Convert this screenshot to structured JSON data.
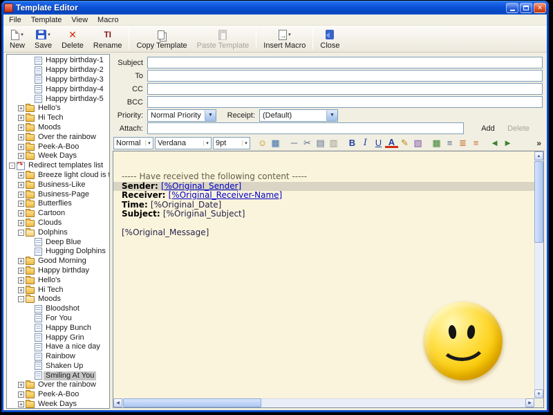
{
  "window": {
    "title": "Template Editor",
    "close_glyph": "✕"
  },
  "menubar": {
    "items": [
      "File",
      "Template",
      "View",
      "Macro"
    ]
  },
  "toolbar": {
    "dropdown_glyph": "▾",
    "buttons": [
      {
        "label": "New",
        "icon": "new-template-icon",
        "enabled": true,
        "dropdown": true,
        "sep_after": false
      },
      {
        "label": "Save",
        "icon": "save-icon",
        "enabled": true,
        "dropdown": true,
        "sep_after": false
      },
      {
        "label": "Delete",
        "icon": "delete-icon",
        "glyph": "✕",
        "enabled": true,
        "dropdown": false,
        "sep_after": false
      },
      {
        "label": "Rename",
        "icon": "rename-icon",
        "glyph": "TI",
        "enabled": true,
        "dropdown": false,
        "sep_after": true
      },
      {
        "label": "Copy Template",
        "icon": "copy-template-icon",
        "enabled": true,
        "dropdown": false,
        "sep_after": false
      },
      {
        "label": "Paste Template",
        "icon": "paste-template-icon",
        "enabled": false,
        "dropdown": false,
        "sep_after": true
      },
      {
        "label": "Insert Macro",
        "icon": "insert-macro-icon",
        "enabled": true,
        "dropdown": true,
        "sep_after": true
      },
      {
        "label": "Close",
        "icon": "close-window-icon",
        "enabled": true,
        "dropdown": false,
        "sep_after": false
      }
    ]
  },
  "form": {
    "fields": [
      {
        "label": "Subject"
      },
      {
        "label": "To"
      },
      {
        "label": "CC"
      },
      {
        "label": "BCC"
      }
    ],
    "priority": {
      "label": "Priority:",
      "value": "Normal Priority"
    },
    "receipt": {
      "label": "Receipt:",
      "value": "(Default)"
    },
    "attach": {
      "label": "Attach:",
      "add_label": "Add",
      "delete_label": "Delete"
    },
    "combo_arrow": "▼"
  },
  "format_toolbar": {
    "style_value": "Normal",
    "font_value": "Verdana",
    "size_value": "9pt",
    "spin_glyph": "▾",
    "overflow": "»",
    "icons": [
      {
        "name": "smiley-icon",
        "glyph": "☺",
        "color": "#C98A00"
      },
      {
        "name": "insert-image-icon",
        "glyph": "▦",
        "color": "#3B6EA5"
      },
      {
        "name": "horizontal-rule-icon",
        "glyph": "─",
        "color": "#5A6B8C",
        "sep": true
      },
      {
        "name": "cut-icon",
        "glyph": "✂",
        "color": "#5A6B8C"
      },
      {
        "name": "copy-icon",
        "glyph": "▤",
        "color": "#5A6B8C"
      },
      {
        "name": "paste-icon",
        "glyph": "▥",
        "color": "#9A948A"
      },
      {
        "name": "bold-icon",
        "glyph": "B",
        "color": "#1F3F9F",
        "sep": true
      },
      {
        "name": "italic-icon",
        "glyph": "I",
        "color": "#1F3F9F"
      },
      {
        "name": "underline-icon",
        "glyph": "U",
        "color": "#1F3F9F"
      },
      {
        "name": "font-color-icon",
        "glyph": "A",
        "color": "#1F3F9F"
      },
      {
        "name": "pencil-icon",
        "glyph": "✎",
        "color": "#B8860B"
      },
      {
        "name": "fill-color-icon",
        "glyph": "▧",
        "color": "#7A4A9F"
      },
      {
        "name": "table-icon",
        "glyph": "▦",
        "color": "#3C8031",
        "sep": true
      },
      {
        "name": "align-left-icon",
        "glyph": "≡",
        "color": "#5A6B8C"
      },
      {
        "name": "numbered-list-icon",
        "glyph": "≣",
        "color": "#C87137"
      },
      {
        "name": "bullet-list-icon",
        "glyph": "≡",
        "color": "#C87137"
      },
      {
        "name": "outdent-icon",
        "glyph": "◄",
        "color": "#3C8031",
        "sep": true
      },
      {
        "name": "indent-icon",
        "glyph": "►",
        "color": "#3C8031"
      }
    ]
  },
  "tree": {
    "items": [
      {
        "label": "Happy birthday-1",
        "level": 2,
        "icon": "template"
      },
      {
        "label": "Happy birthday-2",
        "level": 2,
        "icon": "template"
      },
      {
        "label": "Happy birthday-3",
        "level": 2,
        "icon": "template"
      },
      {
        "label": "Happy birthday-4",
        "level": 2,
        "icon": "template"
      },
      {
        "label": "Happy birthday-5",
        "level": 2,
        "icon": "template"
      },
      {
        "label": "Hello's",
        "level": 1,
        "icon": "folder",
        "expander": "+"
      },
      {
        "label": "Hi Tech",
        "level": 1,
        "icon": "folder",
        "expander": "+"
      },
      {
        "label": "Moods",
        "level": 1,
        "icon": "folder",
        "expander": "+"
      },
      {
        "label": "Over the rainbow",
        "level": 1,
        "icon": "folder",
        "expander": "+"
      },
      {
        "label": "Peek-A-Boo",
        "level": 1,
        "icon": "folder",
        "expander": "+"
      },
      {
        "label": "Week Days",
        "level": 1,
        "icon": "folder",
        "expander": "+"
      },
      {
        "label": "Redirect templates list",
        "level": 0,
        "icon": "redirect",
        "expander": "-"
      },
      {
        "label": "Breeze light cloud is thin",
        "level": 1,
        "icon": "folder",
        "expander": "+"
      },
      {
        "label": "Business-Like",
        "level": 1,
        "icon": "folder",
        "expander": "+"
      },
      {
        "label": "Business-Page",
        "level": 1,
        "icon": "folder",
        "expander": "+"
      },
      {
        "label": "Butterflies",
        "level": 1,
        "icon": "folder",
        "expander": "+"
      },
      {
        "label": "Cartoon",
        "level": 1,
        "icon": "folder",
        "expander": "+"
      },
      {
        "label": "Clouds",
        "level": 1,
        "icon": "folder",
        "expander": "+"
      },
      {
        "label": "Dolphins",
        "level": 1,
        "icon": "folder-open",
        "expander": "-"
      },
      {
        "label": "Deep Blue",
        "level": 2,
        "icon": "template"
      },
      {
        "label": "Hugging Dolphins",
        "level": 2,
        "icon": "template"
      },
      {
        "label": "Good Morning",
        "level": 1,
        "icon": "folder",
        "expander": "+"
      },
      {
        "label": "Happy birthday",
        "level": 1,
        "icon": "folder",
        "expander": "+"
      },
      {
        "label": "Hello's",
        "level": 1,
        "icon": "folder",
        "expander": "+"
      },
      {
        "label": "Hi Tech",
        "level": 1,
        "icon": "folder",
        "expander": "+"
      },
      {
        "label": "Moods",
        "level": 1,
        "icon": "folder-open",
        "expander": "-"
      },
      {
        "label": "Bloodshot",
        "level": 2,
        "icon": "template"
      },
      {
        "label": "For You",
        "level": 2,
        "icon": "template"
      },
      {
        "label": "Happy Bunch",
        "level": 2,
        "icon": "template"
      },
      {
        "label": "Happy Grin",
        "level": 2,
        "icon": "template"
      },
      {
        "label": "Have a nice day",
        "level": 2,
        "icon": "template"
      },
      {
        "label": "Rainbow",
        "level": 2,
        "icon": "template"
      },
      {
        "label": "Shaken Up",
        "level": 2,
        "icon": "template"
      },
      {
        "label": "Smiling At You",
        "level": 2,
        "icon": "template",
        "selected": true
      },
      {
        "label": "Over the rainbow",
        "level": 1,
        "icon": "folder",
        "expander": "+"
      },
      {
        "label": "Peek-A-Boo",
        "level": 1,
        "icon": "folder",
        "expander": "+"
      },
      {
        "label": "Week Days",
        "level": 1,
        "icon": "folder",
        "expander": "+"
      }
    ]
  },
  "editor": {
    "header_line": "----- Have received the following content -----",
    "fields": [
      {
        "label": "Sender:",
        "value": "[%Original_Sender]",
        "link": true,
        "highlighted": true
      },
      {
        "label": "Receiver:",
        "value": "[%Original_Receiver-Name]",
        "link": true,
        "highlighted": false
      },
      {
        "label": "Time:",
        "value": "[%Original_Date]",
        "link": false,
        "highlighted": false
      },
      {
        "label": "Subject:",
        "value": "[%Original_Subject]",
        "link": false,
        "highlighted": false
      }
    ],
    "body_line": "[%Original_Message]",
    "smiley_image": "smiley-face-image",
    "colors": {
      "background": "#FBF4DC",
      "highlight": "#D9D4C3",
      "link": "#0000C8",
      "text": "#23234A",
      "muted": "#5E5E49"
    }
  },
  "scrollbar": {
    "up": "▲",
    "down": "▼",
    "left": "◀",
    "right": "▶"
  }
}
